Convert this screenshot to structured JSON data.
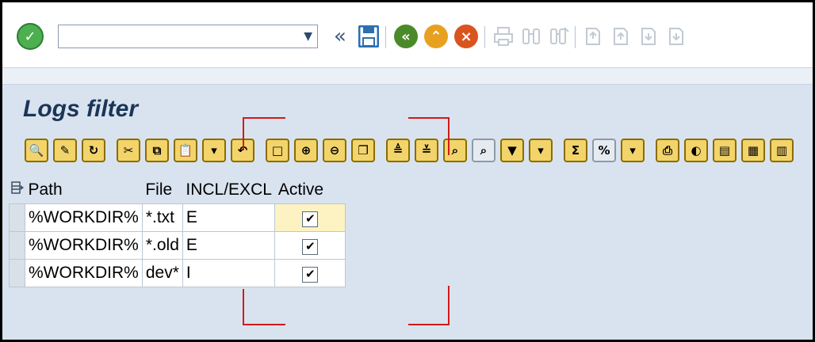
{
  "screen": {
    "title": "Logs filter"
  },
  "system_toolbar": {
    "command_field_value": "",
    "dropdown_glyph": "▼",
    "back_arrows": "«"
  },
  "grid": {
    "columns": [
      "Path",
      "File",
      "INCL/EXCL",
      "Active"
    ],
    "rows": [
      {
        "path": "%WORKDIR%",
        "file": "*.txt",
        "incl_excl": "E",
        "active": "✔"
      },
      {
        "path": "%WORKDIR%",
        "file": "*.old",
        "incl_excl": "E",
        "active": "✔"
      },
      {
        "path": "%WORKDIR%",
        "file": "dev*",
        "incl_excl": "I",
        "active": "✔"
      }
    ]
  },
  "colors": {
    "title": "#1b3558",
    "annotation": "#d11a1a",
    "confirm": "#4caf50",
    "back": "#4a8a2a",
    "exit": "#e8a020",
    "cancel": "#d9541e"
  },
  "icons": {
    "confirm": "checkmark-icon",
    "save": "save-icon",
    "back": "back-icon",
    "exit": "exit-icon",
    "cancel": "cancel-icon",
    "print": "print-icon",
    "find": "find-icon",
    "find_next": "find-next-icon",
    "first_page": "first-page-icon",
    "prev_page": "previous-page-icon",
    "next_page": "next-page-icon",
    "last_page": "last-page-icon"
  }
}
